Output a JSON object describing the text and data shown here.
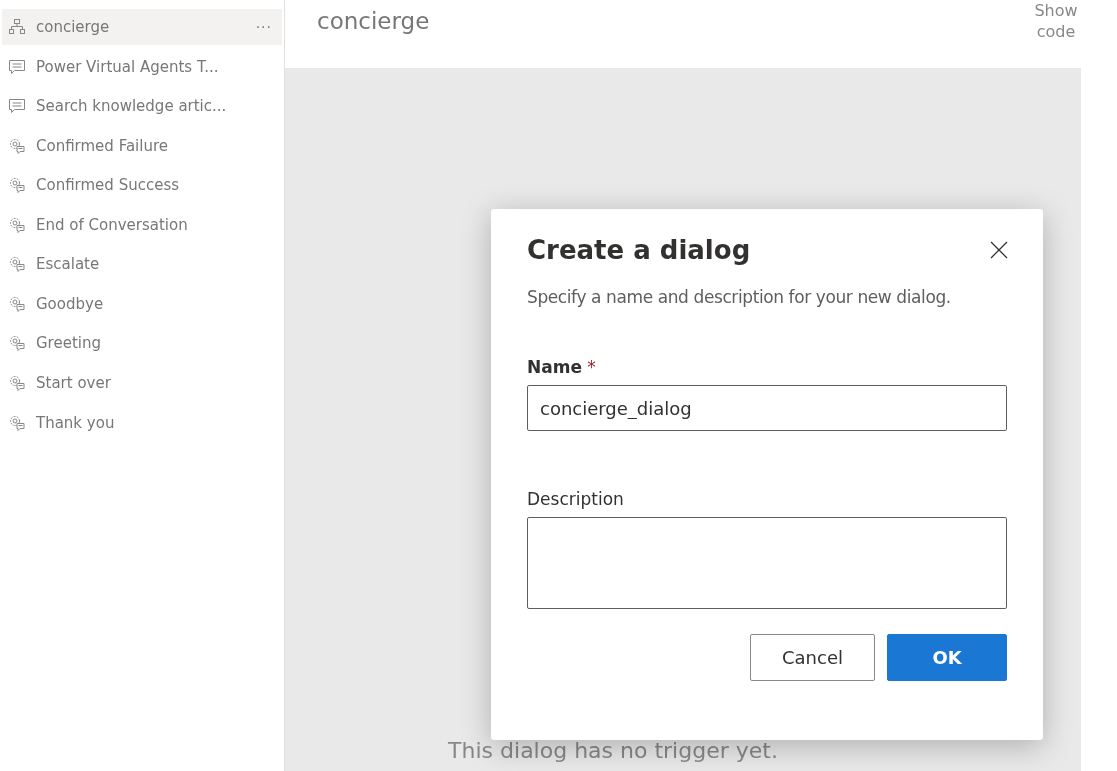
{
  "sidebar": {
    "items": [
      {
        "label": "concierge",
        "kind": "flow",
        "selected": true,
        "more": "···"
      },
      {
        "label": "Power Virtual Agents T...",
        "kind": "chat",
        "selected": false
      },
      {
        "label": "Search knowledge artic...",
        "kind": "chat",
        "selected": false
      },
      {
        "label": "Confirmed Failure",
        "kind": "system",
        "selected": false
      },
      {
        "label": "Confirmed Success",
        "kind": "system",
        "selected": false
      },
      {
        "label": "End of Conversation",
        "kind": "system",
        "selected": false
      },
      {
        "label": "Escalate",
        "kind": "system",
        "selected": false
      },
      {
        "label": "Goodbye",
        "kind": "system",
        "selected": false
      },
      {
        "label": "Greeting",
        "kind": "system",
        "selected": false
      },
      {
        "label": "Start over",
        "kind": "system",
        "selected": false
      },
      {
        "label": "Thank you",
        "kind": "system",
        "selected": false
      }
    ]
  },
  "header": {
    "title": "concierge",
    "show_code": "Show code"
  },
  "canvas": {
    "message": "This dialog has no trigger yet."
  },
  "dialog": {
    "title": "Create a dialog",
    "subtitle": "Specify a name and description for your new dialog.",
    "fields": [
      {
        "label": "Name",
        "required": true,
        "required_mark": "*",
        "value": "concierge_dialog",
        "kind": "line"
      },
      {
        "label": "Description",
        "required": false,
        "kind": "area"
      }
    ],
    "buttons": [
      {
        "label": "Cancel",
        "primary": false
      },
      {
        "label": "OK",
        "primary": true
      }
    ]
  }
}
